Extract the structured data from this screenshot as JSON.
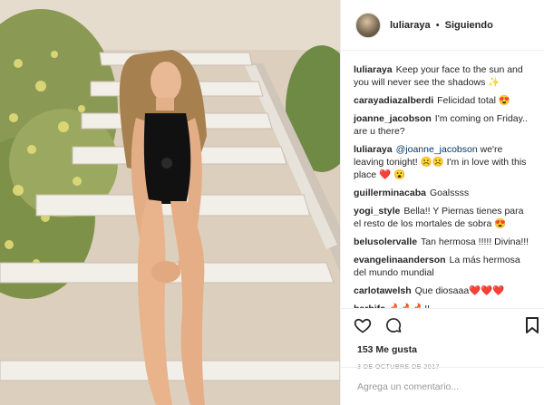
{
  "post": {
    "username": "luliaraya",
    "separator": "•",
    "follow_label": "Siguiendo"
  },
  "comments": [
    {
      "user": "luliaraya",
      "text": "Keep your face to the sun and you will never see the shadows ✨",
      "mention": "",
      "tail": ""
    },
    {
      "user": "carayadiazalberdi",
      "text": "Felicidad total 😍",
      "mention": "",
      "tail": ""
    },
    {
      "user": "joanne_jacobson",
      "text": "I'm coming on Friday.. are u there?",
      "mention": "",
      "tail": ""
    },
    {
      "user": "luliaraya",
      "text": "",
      "mention": "@joanne_jacobson",
      "tail": "we're leaving tonight! ☹️☹️ I'm in love with this place ❤️ 😮"
    },
    {
      "user": "guillerminacaba",
      "text": "Goalssss",
      "mention": "",
      "tail": ""
    },
    {
      "user": "yogi_style",
      "text": "Bella!! Y Piernas tienes para el resto de los mortales de sobra 😍",
      "mention": "",
      "tail": ""
    },
    {
      "user": "belusolervalle",
      "text": "Tan hermosa !!!!! Divina!!!",
      "mention": "",
      "tail": ""
    },
    {
      "user": "evangelinaanderson",
      "text": "La más hermosa del mundo mundial",
      "mention": "",
      "tail": ""
    },
    {
      "user": "carlotawelsh",
      "text": "Que diosaaa❤️❤️❤️",
      "mention": "",
      "tail": ""
    },
    {
      "user": "barbifc",
      "text": "🔥🔥🔥!!",
      "mention": "",
      "tail": ""
    }
  ],
  "actions": {
    "like_icon": "heart-icon",
    "comment_icon": "speech-bubble-icon",
    "save_icon": "bookmark-icon"
  },
  "likes_text": "153 Me gusta",
  "date_text": "3 DE OCTUBRE DE 2017",
  "add_comment": {
    "placeholder": "Agrega un comentario..."
  }
}
